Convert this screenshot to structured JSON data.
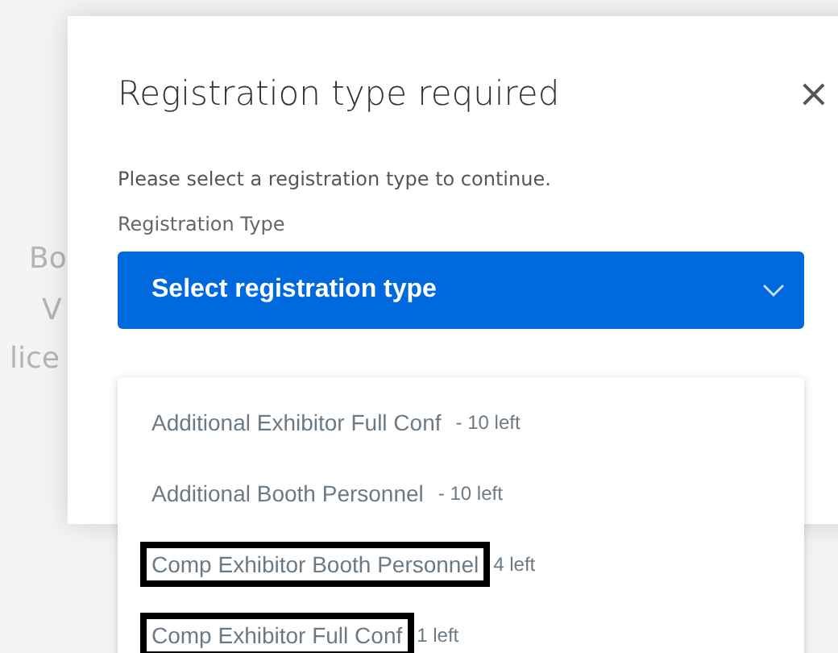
{
  "background_text": [
    "Bo",
    "V",
    "lice"
  ],
  "dialog": {
    "title": "Registration type required",
    "close": "×",
    "message": "Please select a registration type to continue.",
    "field_label": "Registration Type",
    "select": {
      "value": "Select registration type",
      "expanded": true
    }
  },
  "options": [
    {
      "name": "Additional Exhibitor Full Conf",
      "count": "- 10 left",
      "highlighted": false
    },
    {
      "name": "Additional Booth Personnel",
      "count": "- 10 left",
      "highlighted": false
    },
    {
      "name": "Comp Exhibitor Booth Personnel",
      "count": "4 left",
      "highlighted": true
    },
    {
      "name": "Comp Exhibitor Full Conf",
      "count": "1 left",
      "highlighted": true
    }
  ]
}
